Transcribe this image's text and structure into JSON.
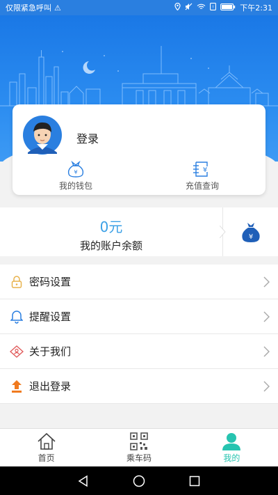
{
  "status_bar": {
    "carrier": "仅限紧急呼叫",
    "time": "下午2:31"
  },
  "profile": {
    "login_label": "登录"
  },
  "card_actions": {
    "wallet": "我的钱包",
    "recharge_query": "充值查询"
  },
  "balance": {
    "amount": "0元",
    "label": "我的账户余额"
  },
  "menu": {
    "items": [
      {
        "label": "密码设置",
        "icon": "lock-icon"
      },
      {
        "label": "提醒设置",
        "icon": "bell-icon"
      },
      {
        "label": "关于我们",
        "icon": "about-icon"
      },
      {
        "label": "退出登录",
        "icon": "logout-icon"
      }
    ]
  },
  "tabs": {
    "home": "首页",
    "ride_code": "乘车码",
    "mine": "我的"
  },
  "colors": {
    "primary": "#2a7fe0",
    "accent": "#27c4b0",
    "amount": "#3ba0e6"
  }
}
